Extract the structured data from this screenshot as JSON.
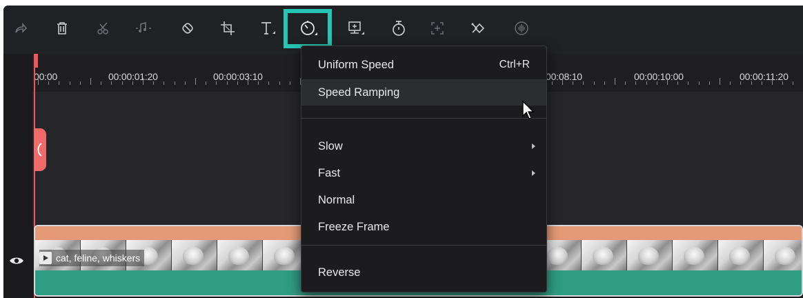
{
  "toolbar": {
    "icons": [
      "redo-icon",
      "delete-icon",
      "cut-icon",
      "audio-icon",
      "tag-icon",
      "crop-icon",
      "text-icon",
      "speed-icon",
      "freeze-icon",
      "timer-icon",
      "add-icon",
      "keyframe-icon",
      "audio-wave-icon"
    ],
    "highlight_color": "#26c6b4"
  },
  "timeline": {
    "ruler_labels": [
      "00:00",
      "00:00:01:20",
      "00:00:03:10",
      "00:08:10",
      "00:00:10:00",
      "00:00:11:20"
    ],
    "playhead_color": "#f2545b"
  },
  "clip": {
    "label": "cat, feline, whiskers",
    "color_top": "#e59a77",
    "color_bottom": "#2f9c84"
  },
  "speed_menu": {
    "uniform_speed": "Uniform Speed",
    "uniform_speed_shortcut": "Ctrl+R",
    "speed_ramping": "Speed Ramping",
    "slow": "Slow",
    "fast": "Fast",
    "normal": "Normal",
    "freeze_frame": "Freeze Frame",
    "reverse": "Reverse"
  }
}
